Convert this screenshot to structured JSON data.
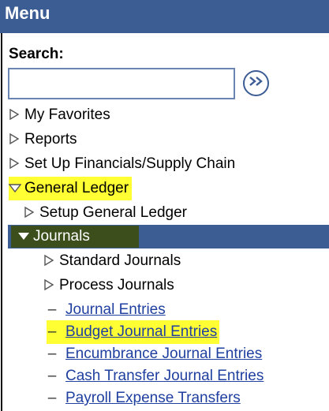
{
  "header": {
    "title": "Menu"
  },
  "search": {
    "label": "Search:",
    "value": "",
    "go_icon": "double-chevron-right-icon"
  },
  "menu": {
    "top_items": [
      {
        "label": "My Favorites",
        "icon": "triangle-right-icon"
      },
      {
        "label": "Reports",
        "icon": "triangle-right-icon"
      },
      {
        "label": "Set Up Financials/Supply Chain",
        "icon": "triangle-right-icon"
      }
    ],
    "general_ledger": {
      "label": "General Ledger",
      "icon": "triangle-down-icon",
      "highlighted": true
    },
    "setup_gl": {
      "label": "Setup General Ledger",
      "icon": "triangle-right-icon"
    },
    "journals": {
      "label": "Journals",
      "icon": "triangle-down-icon",
      "selected": true
    },
    "journal_folders": [
      {
        "label": "Standard Journals",
        "icon": "triangle-right-icon"
      },
      {
        "label": "Process Journals",
        "icon": "triangle-right-icon"
      }
    ],
    "journal_links": [
      {
        "label": "Journal Entries",
        "highlighted": false
      },
      {
        "label": "Budget Journal Entries",
        "highlighted": true
      },
      {
        "label": "Encumbrance Journal Entries",
        "highlighted": false
      },
      {
        "label": "Cash Transfer Journal Entries",
        "highlighted": false
      },
      {
        "label": "Payroll Expense Transfers",
        "highlighted": false
      }
    ]
  },
  "colors": {
    "header_bg": "#3c5c94",
    "link": "#2040a0",
    "highlight": "#ffff33",
    "journals_highlight": "#3b4e1c"
  }
}
